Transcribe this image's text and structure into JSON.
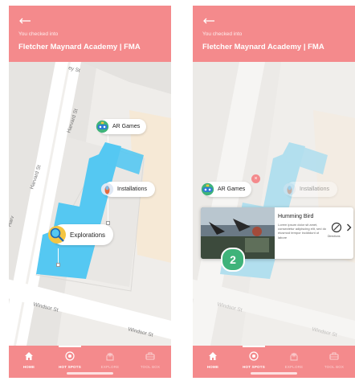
{
  "header": {
    "checked_in_text": "You checked into",
    "venue_name": "Fletcher Maynard Academy | FMA"
  },
  "left_screen": {
    "streets": [
      "Harvard St",
      "Harvard St",
      "Windsor St",
      "Windsor St",
      "Harv",
      "ey St"
    ],
    "pins": {
      "ar_games": "AR Games",
      "installations": "Installations",
      "explorations": "Explorations"
    }
  },
  "right_screen": {
    "streets": [
      "Windsor St",
      "Windsor St"
    ],
    "pins": {
      "ar_games": "AR Games",
      "installations": "Installations"
    },
    "close_label": "×",
    "card": {
      "title": "Humming Bird",
      "description": "Lorem ipsum dolor sit amet, consectetur adipiscing elit, sed do eiusmod tempor incididunt ut labore",
      "nav_label": "Directions",
      "badge": "2"
    }
  },
  "tabbar": {
    "home": "HOME",
    "hot_spots": "HOT SPOTS",
    "explore": "EXPLORE",
    "tool_box": "TOOL BOX"
  },
  "colors": {
    "brand_pink": "#f48a8c",
    "zone_blue": "#55c8f2",
    "ar_green": "#3fb37a"
  },
  "icons": [
    "back-arrow-icon",
    "home-icon",
    "target-icon",
    "hands-icon",
    "toolbox-icon",
    "ar-games-icon",
    "installations-icon",
    "explorations-icon",
    "directions-icon",
    "chevron-right-icon"
  ]
}
